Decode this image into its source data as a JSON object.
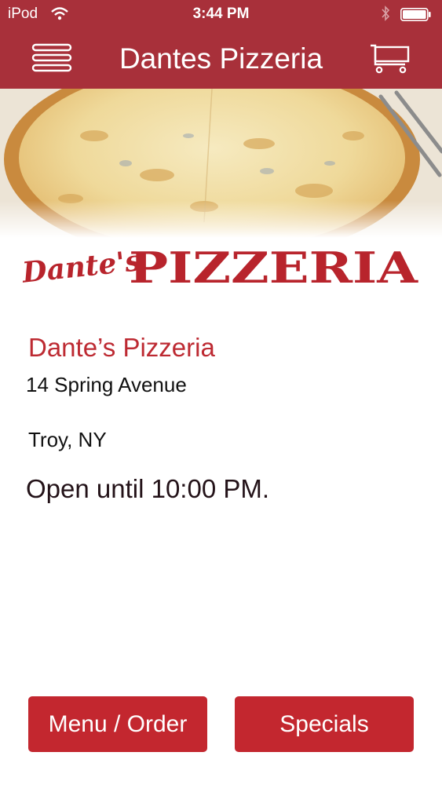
{
  "status_bar": {
    "carrier": "iPod",
    "time": "3:44 PM"
  },
  "nav": {
    "title": "Dantes Pizzeria",
    "menu_icon": "hamburger-menu-icon",
    "cart_icon": "shopping-cart-icon"
  },
  "logo": {
    "script_text": "Dante's",
    "block_text": "PIZZERIA"
  },
  "restaurant": {
    "name": "Dante’s Pizzeria",
    "address": "14 Spring Avenue",
    "city": "Troy, NY",
    "hours": "Open until 10:00 PM."
  },
  "buttons": {
    "menu_order": "Menu / Order",
    "specials": "Specials"
  },
  "colors": {
    "brand_red": "#a8303a",
    "button_red": "#c3272f",
    "name_red": "#bd2a32"
  }
}
